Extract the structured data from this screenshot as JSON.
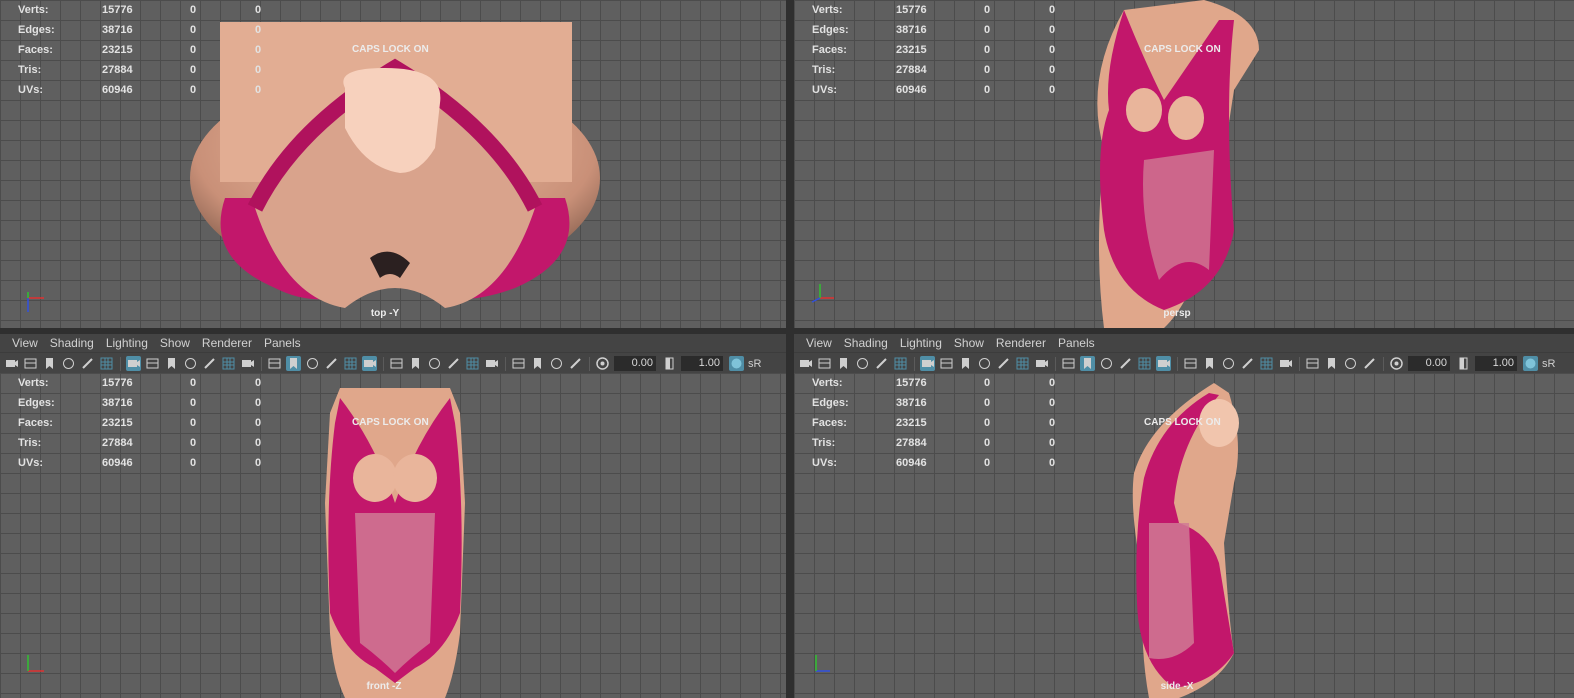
{
  "hud": {
    "rows": [
      {
        "label": "Verts:",
        "v1": "15776",
        "v2": "0",
        "v3": "0"
      },
      {
        "label": "Edges:",
        "v1": "38716",
        "v2": "0",
        "v3": "0"
      },
      {
        "label": "Faces:",
        "v1": "23215",
        "v2": "0",
        "v3": "0"
      },
      {
        "label": "Tris:",
        "v1": "27884",
        "v2": "0",
        "v3": "0"
      },
      {
        "label": "UVs:",
        "v1": "60946",
        "v2": "0",
        "v3": "0"
      }
    ],
    "caps_lock": "CAPS LOCK ON"
  },
  "viewports": {
    "top": {
      "camera": "top -Y"
    },
    "persp": {
      "camera": "persp"
    },
    "front": {
      "camera": "front -Z"
    },
    "side": {
      "camera": "side -X"
    }
  },
  "panel_menu": [
    "View",
    "Shading",
    "Lighting",
    "Show",
    "Renderer",
    "Panels"
  ],
  "toolbar": {
    "exposure": "0.00",
    "gamma": "1.00",
    "color_mgmt_label": "sR",
    "icons": [
      "camera-icon",
      "camera-attributes-icon",
      "bookmark-icon",
      "image-plane-icon",
      "2d-pan-zoom-icon",
      "grease-pencil-icon",
      "grid-icon",
      "film-gate-icon",
      "resolution-gate-icon",
      "gate-mask-icon",
      "field-chart-icon",
      "safe-action-icon",
      "safe-title-icon",
      "wireframe-icon",
      "smooth-shade-icon",
      "use-default-material-icon",
      "wireframe-on-shaded-icon",
      "xray-icon",
      "textured-icon",
      "use-all-lights-icon",
      "shadows-icon",
      "screen-space-ao-icon",
      "motion-blur-icon",
      "multisample-aa-icon",
      "depth-of-field-icon",
      "isolate-select-icon",
      "xray-joints-icon",
      "xray-active-components-icon",
      "backface-culling-icon",
      "exposure-icon",
      "gamma-icon",
      "color-management-icon"
    ]
  },
  "colors": {
    "viewport_bg": "#5f5f5f",
    "grid_line": "#4c4c4c",
    "panel_bg": "#444444",
    "accent": "#4f8ea6",
    "garment": "#c2176b",
    "skin": "#e5a88c"
  }
}
